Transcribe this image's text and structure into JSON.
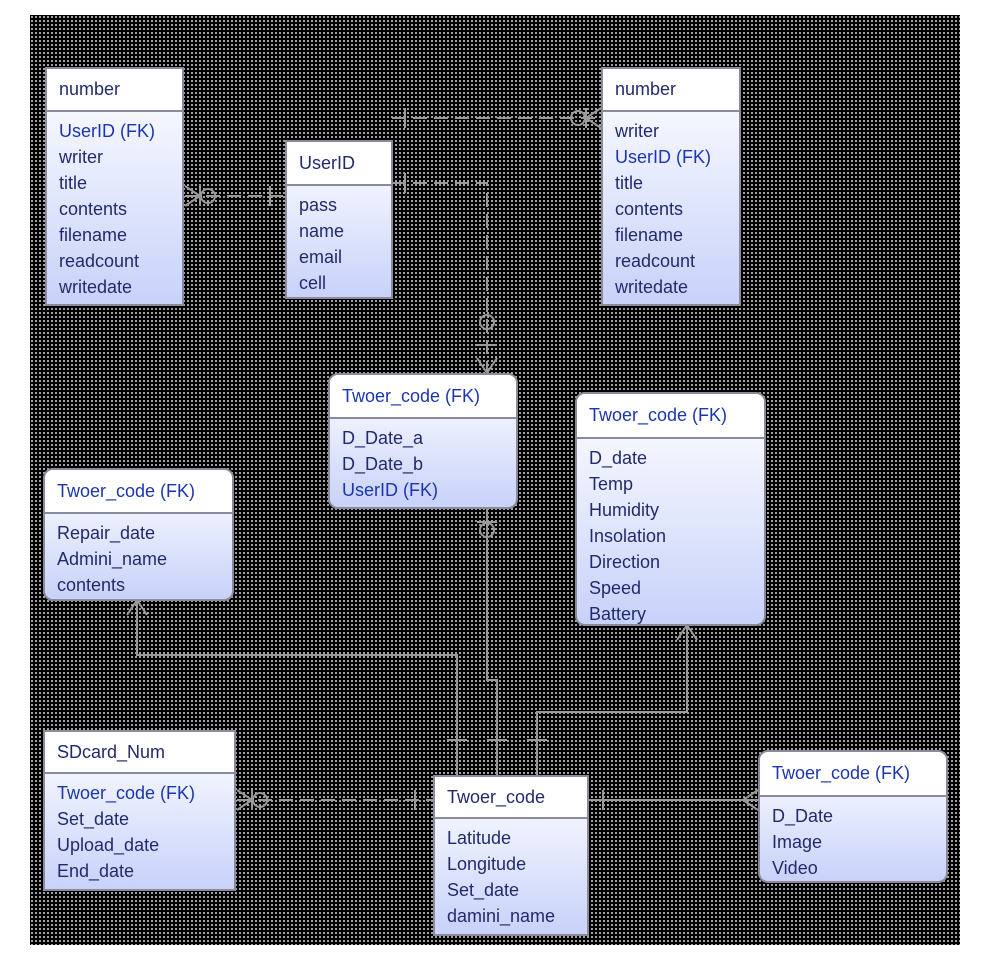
{
  "entities": [
    {
      "key": "board_left",
      "pk": "number",
      "pk_fk": false,
      "attrs": [
        {
          "t": "UserID (FK)",
          "fk": true
        },
        {
          "t": "writer"
        },
        {
          "t": "title"
        },
        {
          "t": "contents"
        },
        {
          "t": "filename"
        },
        {
          "t": "readcount"
        },
        {
          "t": "writedate"
        }
      ]
    },
    {
      "key": "user",
      "pk": "UserID",
      "pk_fk": false,
      "attrs": [
        {
          "t": "pass"
        },
        {
          "t": "name"
        },
        {
          "t": "email"
        },
        {
          "t": "cell"
        }
      ]
    },
    {
      "key": "board_right",
      "pk": "number",
      "pk_fk": false,
      "attrs": [
        {
          "t": "writer"
        },
        {
          "t": "UserID (FK)",
          "fk": true
        },
        {
          "t": "title"
        },
        {
          "t": "contents"
        },
        {
          "t": "filename"
        },
        {
          "t": "readcount"
        },
        {
          "t": "writedate"
        }
      ]
    },
    {
      "key": "date_entity",
      "pk": "Twoer_code (FK)",
      "pk_fk": true,
      "attrs": [
        {
          "t": "D_Date_a"
        },
        {
          "t": "D_Date_b"
        },
        {
          "t": "UserID (FK)",
          "fk": true
        }
      ]
    },
    {
      "key": "weather",
      "pk": "Twoer_code (FK)",
      "pk_fk": true,
      "attrs": [
        {
          "t": "D_date"
        },
        {
          "t": "Temp"
        },
        {
          "t": "Humidity"
        },
        {
          "t": "Insolation"
        },
        {
          "t": "Direction"
        },
        {
          "t": "Speed"
        },
        {
          "t": "Battery"
        }
      ]
    },
    {
      "key": "repair",
      "pk": "Twoer_code (FK)",
      "pk_fk": true,
      "attrs": [
        {
          "t": "Repair_date"
        },
        {
          "t": "Admini_name"
        },
        {
          "t": "contents"
        }
      ]
    },
    {
      "key": "sdcard",
      "pk": "SDcard_Num",
      "pk_fk": false,
      "attrs": [
        {
          "t": "Twoer_code (FK)",
          "fk": true
        },
        {
          "t": "Set_date"
        },
        {
          "t": "Upload_date"
        },
        {
          "t": "End_date"
        }
      ]
    },
    {
      "key": "tower",
      "pk": "Twoer_code",
      "pk_fk": false,
      "attrs": [
        {
          "t": "Latitude"
        },
        {
          "t": "Longitude"
        },
        {
          "t": "Set_date"
        },
        {
          "t": "damini_name"
        }
      ]
    },
    {
      "key": "media",
      "pk": "Twoer_code (FK)",
      "pk_fk": true,
      "attrs": [
        {
          "t": "D_Date"
        },
        {
          "t": "Image"
        },
        {
          "t": "Video"
        }
      ]
    }
  ],
  "colors": {
    "pk_text": "#222a6e",
    "fk_text": "#1b36b0",
    "line": "#9a9a9a",
    "box_bottom": "#c8d2fa"
  }
}
